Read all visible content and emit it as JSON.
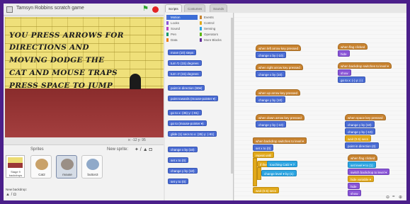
{
  "stage": {
    "title": "Tamsyn Robbins scratch game",
    "text_lines": [
      "YOU PRESS ARROWS FOR",
      "DIRECTIONS AND",
      "MOVING DODGE THE",
      "CAT AND MOUSE TRAPS",
      "PRESS SPACE TO JUMP"
    ],
    "coords": "x: -12  y: 95"
  },
  "sprites": {
    "label": "Sprites",
    "new_sprite_label": "New sprite:",
    "new_sprite_icons": "✦ / ▲ ◘",
    "stage_label": "Stage\n9 backdrops",
    "new_backdrop_label": "New backdrop:",
    "new_backdrop_icons": "▲ / ◘",
    "tiles": [
      {
        "name": "Cat2",
        "color": "#c9a26a"
      },
      {
        "name": "mouse",
        "color": "#9a8f86"
      },
      {
        "name": "button3",
        "color": "#8fa9c9"
      }
    ]
  },
  "tabs": [
    "Scripts",
    "Costumes",
    "Sounds"
  ],
  "categories": [
    {
      "label": "Motion",
      "color": "#4a6cd4",
      "active": true
    },
    {
      "label": "Events",
      "color": "#c88330"
    },
    {
      "label": "Looks",
      "color": "#8a55d7"
    },
    {
      "label": "Control",
      "color": "#e1a91a"
    },
    {
      "label": "Sound",
      "color": "#bb42c3"
    },
    {
      "label": "Sensing",
      "color": "#2ca5e2"
    },
    {
      "label": "Pen",
      "color": "#0e9a6c"
    },
    {
      "label": "Operators",
      "color": "#5cb712"
    },
    {
      "label": "Data",
      "color": "#ee7d16"
    },
    {
      "label": "More Blocks",
      "color": "#632d99"
    }
  ],
  "palette_blocks": [
    "move (10) steps",
    "turn ↻ (15) degrees",
    "turn ↺ (15) degrees",
    "point in direction (90▾)",
    "point towards (mouse-pointer ▾)",
    "go to x: (35) y: (-91)",
    "go to (mouse-pointer ▾)",
    "glide (1) secs to x: (35) y: (-91)",
    "change x by (10)",
    "set x to (0)",
    "change y by (10)",
    "set y to (0)"
  ],
  "scripts": {
    "events": [
      "when left arrow key pressed",
      "when right arrow key pressed",
      "when up arrow key pressed",
      "when down arrow key pressed",
      "when backdrop switches to level ▾",
      "when flag clicked",
      "when backdrop switches to level ▾",
      "when space key pressed",
      "when flag clicked"
    ],
    "motion": [
      "change x by (-10)",
      "change x by (10)",
      "change y by (10)",
      "change y by (-10)",
      "set x to (0)",
      "change y by (10)",
      "change y by (-10)",
      "go to x: (-) y: (-)"
    ],
    "looks": [
      "hide",
      "show",
      "switch backdrop to level ▾",
      "hide",
      "show"
    ],
    "control": [
      "repeat until",
      "wait (0.5) secs",
      "if then",
      "wait (0.5) secs",
      "hide variable ▾"
    ],
    "sensing": [
      "touching Cat2 ▾ ?",
      "change level ▾ by (1)",
      "set level ▾ to (1)"
    ],
    "other": [
      "point in direction (0)",
      "dir (0)",
      "wait (1) secs"
    ]
  },
  "zoom": [
    "⊖",
    "=",
    "⊕"
  ]
}
